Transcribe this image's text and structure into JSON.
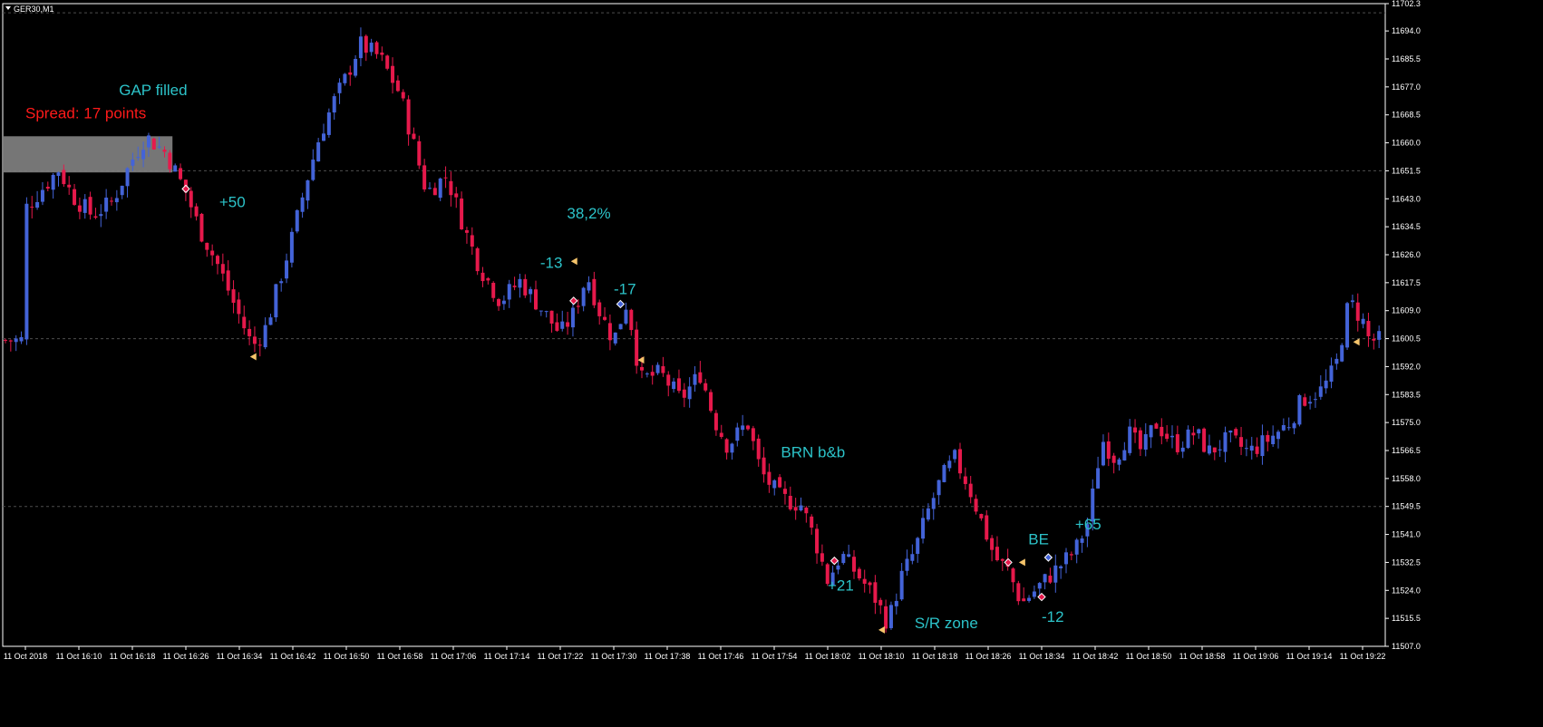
{
  "window": {
    "symbol_label": "GER30,M1"
  },
  "colors": {
    "background": "#000000",
    "bull": "#4363d8",
    "bear": "#e6194b",
    "grid": "#4d4d4d",
    "axis_text": "#ffffff",
    "annotation": "#2cc3c9",
    "spread_text": "#ff1a1a",
    "zone_fill": "#808080"
  },
  "spread_label": "Spread: 17 points",
  "chart_data": {
    "type": "candlestick",
    "title": "",
    "ylim": [
      11507.0,
      11702.3
    ],
    "y_ticks": [
      "11702.3",
      "11694.0",
      "11685.5",
      "11677.0",
      "11668.5",
      "11660.0",
      "11651.5",
      "11643.0",
      "11634.5",
      "11626.0",
      "11617.5",
      "11609.0",
      "11600.5",
      "11592.0",
      "11583.5",
      "11575.0",
      "11566.5",
      "11558.0",
      "11549.5",
      "11541.0",
      "11532.5",
      "11524.0",
      "11515.5",
      "11507.0"
    ],
    "x_ticks": [
      "11 Oct 2018",
      "11 Oct 16:10",
      "11 Oct 16:18",
      "11 Oct 16:26",
      "11 Oct 16:34",
      "11 Oct 16:42",
      "11 Oct 16:50",
      "11 Oct 16:58",
      "11 Oct 17:06",
      "11 Oct 17:14",
      "11 Oct 17:22",
      "11 Oct 17:30",
      "11 Oct 17:38",
      "11 Oct 17:46",
      "11 Oct 17:54",
      "11 Oct 18:02",
      "11 Oct 18:10",
      "11 Oct 18:18",
      "11 Oct 18:26",
      "11 Oct 18:34",
      "11 Oct 18:42",
      "11 Oct 18:50",
      "11 Oct 18:58",
      "11 Oct 19:06",
      "11 Oct 19:14",
      "11 Oct 19:22"
    ],
    "horizontal_levels": [
      11651.5,
      11600.5,
      11549.5
    ],
    "zone": {
      "price_top": 11662.0,
      "price_bottom": 11651.0,
      "time_start": "11 Oct 2018",
      "time_end": "11 Oct 16:25"
    },
    "close_path": [
      [
        "11 Oct 2018",
        11640
      ],
      [
        "11 Oct 16:08",
        11652
      ],
      [
        "11 Oct 16:10",
        11644
      ],
      [
        "11 Oct 16:13",
        11638
      ],
      [
        "11 Oct 16:16",
        11642
      ],
      [
        "11 Oct 16:19",
        11655
      ],
      [
        "11 Oct 16:21",
        11662
      ],
      [
        "11 Oct 16:24",
        11657
      ],
      [
        "11 Oct 16:27",
        11645
      ],
      [
        "11 Oct 16:29",
        11634
      ],
      [
        "11 Oct 16:32",
        11622
      ],
      [
        "11 Oct 16:34",
        11612
      ],
      [
        "11 Oct 16:37",
        11598
      ],
      [
        "11 Oct 16:39",
        11604
      ],
      [
        "11 Oct 16:41",
        11618
      ],
      [
        "11 Oct 16:43",
        11632
      ],
      [
        "11 Oct 16:45",
        11648
      ],
      [
        "11 Oct 16:47",
        11662
      ],
      [
        "11 Oct 16:49",
        11672
      ],
      [
        "11 Oct 16:51",
        11680
      ],
      [
        "11 Oct 16:53",
        11690
      ],
      [
        "11 Oct 16:56",
        11686
      ],
      [
        "11 Oct 16:59",
        11675
      ],
      [
        "11 Oct 17:01",
        11660
      ],
      [
        "11 Oct 17:03",
        11645
      ],
      [
        "11 Oct 17:06",
        11650
      ],
      [
        "11 Oct 17:09",
        11632
      ],
      [
        "11 Oct 17:11",
        11622
      ],
      [
        "11 Oct 17:14",
        11612
      ],
      [
        "11 Oct 17:17",
        11618
      ],
      [
        "11 Oct 17:20",
        11610
      ],
      [
        "11 Oct 17:23",
        11602
      ],
      [
        "11 Oct 17:25",
        11608
      ],
      [
        "11 Oct 17:27",
        11620
      ],
      [
        "11 Oct 17:29",
        11608
      ],
      [
        "11 Oct 17:31",
        11600
      ],
      [
        "11 Oct 17:33",
        11612
      ],
      [
        "11 Oct 17:35",
        11588
      ],
      [
        "11 Oct 17:38",
        11590
      ],
      [
        "11 Oct 17:41",
        11582
      ],
      [
        "11 Oct 17:44",
        11590
      ],
      [
        "11 Oct 17:46",
        11576
      ],
      [
        "11 Oct 17:48",
        11568
      ],
      [
        "11 Oct 17:51",
        11575
      ],
      [
        "11 Oct 17:53",
        11560
      ],
      [
        "11 Oct 17:56",
        11552
      ],
      [
        "11 Oct 17:59",
        11550
      ],
      [
        "11 Oct 18:01",
        11540
      ],
      [
        "11 Oct 18:03",
        11527
      ],
      [
        "11 Oct 18:05",
        11535
      ],
      [
        "11 Oct 18:07",
        11530
      ],
      [
        "11 Oct 18:10",
        11522
      ],
      [
        "11 Oct 18:12",
        11514
      ],
      [
        "11 Oct 18:14",
        11528
      ],
      [
        "11 Oct 18:16",
        11536
      ],
      [
        "11 Oct 18:18",
        11548
      ],
      [
        "11 Oct 18:20",
        11558
      ],
      [
        "11 Oct 18:22",
        11564
      ],
      [
        "11 Oct 18:24",
        11556
      ],
      [
        "11 Oct 18:26",
        11545
      ],
      [
        "11 Oct 18:28",
        11534
      ],
      [
        "11 Oct 18:30",
        11530
      ],
      [
        "11 Oct 18:32",
        11520
      ],
      [
        "11 Oct 18:34",
        11524
      ],
      [
        "11 Oct 18:36",
        11528
      ],
      [
        "11 Oct 18:38",
        11532
      ],
      [
        "11 Oct 18:40",
        11536
      ],
      [
        "11 Oct 18:42",
        11545
      ],
      [
        "11 Oct 18:44",
        11570
      ],
      [
        "11 Oct 18:46",
        11564
      ],
      [
        "11 Oct 18:48",
        11572
      ],
      [
        "11 Oct 18:50",
        11566
      ],
      [
        "11 Oct 18:52",
        11575
      ],
      [
        "11 Oct 18:55",
        11568
      ],
      [
        "11 Oct 18:58",
        11572
      ],
      [
        "11 Oct 19:00",
        11566
      ],
      [
        "11 Oct 19:03",
        11570
      ],
      [
        "11 Oct 19:06",
        11566
      ],
      [
        "11 Oct 19:09",
        11570
      ],
      [
        "11 Oct 19:12",
        11575
      ],
      [
        "11 Oct 19:14",
        11582
      ],
      [
        "11 Oct 19:17",
        11585
      ],
      [
        "11 Oct 19:19",
        11592
      ],
      [
        "11 Oct 19:21",
        11612
      ],
      [
        "11 Oct 19:23",
        11606
      ],
      [
        "11 Oct 19:24",
        11600
      ]
    ],
    "annotations": [
      {
        "text": "Spread: 17 points",
        "time": "11 Oct 2018",
        "price": 11667.5,
        "color": "spread"
      },
      {
        "text": "GAP filled",
        "time": "11 Oct 16:17",
        "price": 11674.5,
        "color": "ann"
      },
      {
        "text": "+50",
        "time": "11 Oct 16:32",
        "price": 11640.5,
        "color": "ann"
      },
      {
        "text": "38,2%",
        "time": "11 Oct 17:24",
        "price": 11637.0,
        "color": "ann"
      },
      {
        "text": "-13",
        "time": "11 Oct 17:20",
        "price": 11622.0,
        "color": "ann"
      },
      {
        "text": "-17",
        "time": "11 Oct 17:31",
        "price": 11614.0,
        "color": "ann"
      },
      {
        "text": "BRN b&b",
        "time": "11 Oct 17:56",
        "price": 11564.5,
        "color": "ann"
      },
      {
        "text": "+21",
        "time": "11 Oct 18:03",
        "price": 11524.0,
        "color": "ann"
      },
      {
        "text": "S/R zone",
        "time": "11 Oct 18:16",
        "price": 11512.5,
        "color": "ann"
      },
      {
        "text": "BE",
        "time": "11 Oct 18:33",
        "price": 11538.0,
        "color": "ann"
      },
      {
        "text": "+65",
        "time": "11 Oct 18:40",
        "price": 11542.5,
        "color": "ann"
      },
      {
        "text": "-12",
        "time": "11 Oct 18:35",
        "price": 11514.5,
        "color": "ann"
      }
    ],
    "trade_markers": [
      {
        "time": "11 Oct 16:27",
        "price": 11646.0,
        "kind": "entry-sell"
      },
      {
        "time": "11 Oct 16:37",
        "price": 11595.0,
        "kind": "exit"
      },
      {
        "time": "11 Oct 17:25",
        "price": 11624.0,
        "kind": "exit"
      },
      {
        "time": "11 Oct 17:25",
        "price": 11612.0,
        "kind": "entry-sell"
      },
      {
        "time": "11 Oct 17:32",
        "price": 11611.0,
        "kind": "entry-buy"
      },
      {
        "time": "11 Oct 17:35",
        "price": 11594.0,
        "kind": "exit"
      },
      {
        "time": "11 Oct 18:04",
        "price": 11533.0,
        "kind": "entry-sell"
      },
      {
        "time": "11 Oct 18:11",
        "price": 11512.0,
        "kind": "exit"
      },
      {
        "time": "11 Oct 18:30",
        "price": 11532.5,
        "kind": "entry-sell"
      },
      {
        "time": "11 Oct 18:32",
        "price": 11532.5,
        "kind": "exit"
      },
      {
        "time": "11 Oct 18:35",
        "price": 11522.0,
        "kind": "entry-sell"
      },
      {
        "time": "11 Oct 18:36",
        "price": 11534.0,
        "kind": "entry-buy"
      },
      {
        "time": "11 Oct 19:22",
        "price": 11599.5,
        "kind": "exit"
      }
    ]
  }
}
